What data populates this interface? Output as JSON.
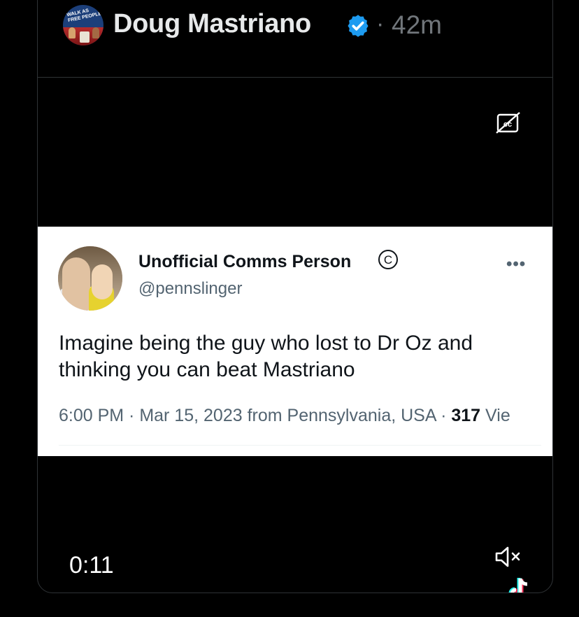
{
  "post": {
    "author_name": "Doug Mastriano",
    "separator": "·",
    "time_ago": "42m",
    "avatar_text": "WALK AS FREE PEOPLE",
    "verified_icon": "verified-badge-icon",
    "accent_color": "#1d9bf0"
  },
  "video": {
    "captions_icon": "closed-captions-off-icon",
    "elapsed": "0:11",
    "mute_icon": "muted-speaker-icon",
    "watermark_icon": "tiktok-logo-icon"
  },
  "embedded_tweet": {
    "author_name": "Unofficial Comms Person",
    "badge_symbol": "©",
    "handle": "@pennslinger",
    "more_label": "•••",
    "text": "Imagine being the guy who lost to Dr Oz and thinking you can beat Mastriano",
    "meta_prefix": "6:00 PM · Mar 15, 2023 from Pennsylvania, USA · ",
    "views_count": "317",
    "views_label": " Vie"
  }
}
